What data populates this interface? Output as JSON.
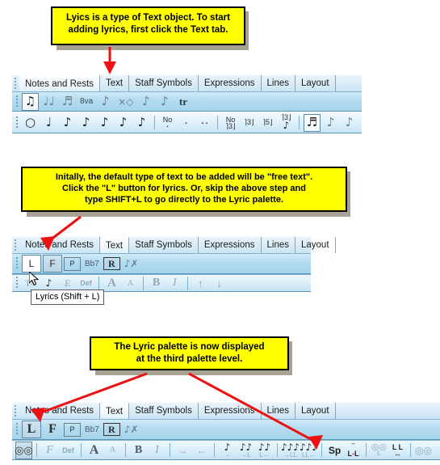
{
  "callouts": [
    {
      "id": "callout-text-tab",
      "lines": [
        "Lyics is a type of Text object. To start",
        "adding lyrics, first click the Text tab."
      ]
    },
    {
      "id": "callout-free-text",
      "lines": [
        "Initally, the default type of text to be added will be \"free text\".",
        "Click the \"L\" button for lyrics.  Or, skip the above step and",
        "type SHIFT+L to go directly to the Lyric palette."
      ]
    },
    {
      "id": "callout-third-level",
      "lines": [
        "The Lyric palette is now displayed",
        "at the third palette level."
      ]
    }
  ],
  "tabs": {
    "labels": [
      "Notes and Rests",
      "Text",
      "Staff Symbols",
      "Expressions",
      "Lines",
      "Layout"
    ],
    "active_top": "Notes and Rests",
    "active_middle": "Text",
    "active_bottom": "Text"
  },
  "section_top": {
    "row_articulations": [
      {
        "name": "beam-notes-icon",
        "glyph": "♫",
        "pressed": true
      },
      {
        "name": "slur-icon",
        "glyph": "♩♩",
        "pressed": false
      },
      {
        "name": "tuplet-notes-icon",
        "glyph": "♬",
        "pressed": false
      },
      {
        "name": "octave-8va-label",
        "glyph": "8va",
        "pressed": false
      },
      {
        "name": "articulation-icon",
        "glyph": "♩",
        "pressed": false
      },
      {
        "name": "noteheads-icon",
        "glyph": "x",
        "pressed": false
      },
      {
        "name": "grace-note-icon",
        "glyph": "♪",
        "pressed": false
      },
      {
        "name": "flag-icon",
        "glyph": "♪",
        "pressed": false
      },
      {
        "name": "trill-icon",
        "glyph": "tr",
        "pressed": false
      }
    ],
    "row_durations": [
      {
        "name": "whole-note-button",
        "glyph": "○"
      },
      {
        "name": "half-note-button",
        "glyph": "♩"
      },
      {
        "name": "quarter-note-button",
        "glyph": "♩"
      },
      {
        "name": "eighth-note-button",
        "glyph": "♪"
      },
      {
        "name": "sixteenth-note-button",
        "glyph": "♪"
      },
      {
        "name": "thirtysecond-note-button",
        "glyph": "♪"
      },
      {
        "name": "sixtyfourth-note-button",
        "glyph": "♪"
      }
    ],
    "row_dots": [
      {
        "name": "no-dot-button",
        "label": "No",
        "dots": 1
      },
      {
        "name": "one-dot-button",
        "label": "",
        "dots": 1
      },
      {
        "name": "two-dot-button",
        "label": "",
        "dots": 2
      }
    ],
    "row_tuplets": [
      {
        "name": "no-tuplet-button",
        "top": "No",
        "bottom": "3"
      },
      {
        "name": "triplet-button",
        "bottom": "3"
      },
      {
        "name": "quintuplet-button",
        "bottom": "5"
      },
      {
        "name": "custom-tuplet-button",
        "bottom": "3"
      }
    ],
    "row_stems": [
      {
        "name": "stem-auto-button",
        "pressed": true
      },
      {
        "name": "stem-up-button",
        "pressed": false
      },
      {
        "name": "stem-down-button",
        "pressed": false
      }
    ]
  },
  "text_palette": {
    "buttons": [
      {
        "name": "lyrics-L-button",
        "label": "L",
        "state_middle": "normal",
        "state_bottom": "pressed"
      },
      {
        "name": "free-text-F-button",
        "label": "F",
        "state_middle": "pressed",
        "state_bottom": "normal"
      },
      {
        "name": "page-text-button",
        "label": "P",
        "state_middle": "normal",
        "state_bottom": "normal"
      },
      {
        "name": "chord-symbol-button",
        "label": "Bb7",
        "state_middle": "normal",
        "state_bottom": "normal"
      },
      {
        "name": "rehearsal-mark-button",
        "label": "R",
        "state_middle": "normal",
        "state_bottom": "normal"
      },
      {
        "name": "hide-text-button",
        "label": "",
        "state_middle": "normal",
        "state_bottom": "normal"
      }
    ]
  },
  "middle_third_row": {
    "buttons": [
      {
        "name": "text-tool-icon",
        "label": "T&"
      },
      {
        "name": "dynamics-icon",
        "label": ""
      },
      {
        "name": "expression-E-icon",
        "label": "E"
      },
      {
        "name": "default-font-button",
        "label": "Def"
      },
      {
        "name": "font-size-large-button",
        "label": "A"
      },
      {
        "name": "font-size-small-button",
        "label": "A"
      },
      {
        "name": "bold-button",
        "label": "B"
      },
      {
        "name": "italic-button",
        "label": "I"
      },
      {
        "name": "align-top-button",
        "label": ""
      },
      {
        "name": "align-bottom-button",
        "label": ""
      }
    ]
  },
  "tooltip": {
    "name": "lyrics-tooltip",
    "text": "Lyrics (Shift + L)"
  },
  "lyric_palette": {
    "buttons": [
      {
        "name": "lyric-view-glasses-button",
        "label": "",
        "pressed": true
      },
      {
        "name": "lyric-font-F-button",
        "label": "F"
      },
      {
        "name": "lyric-default-button",
        "label": "Def"
      },
      {
        "name": "lyric-size-large-button",
        "label": "A"
      },
      {
        "name": "lyric-size-small-button",
        "label": "A"
      },
      {
        "name": "lyric-bold-button",
        "label": "B"
      },
      {
        "name": "lyric-italic-button",
        "label": "I"
      },
      {
        "name": "lyric-shift-right-button",
        "label": "→"
      },
      {
        "name": "lyric-shift-left-button",
        "label": "←"
      },
      {
        "name": "lyric-note-right-button",
        "label": ""
      },
      {
        "name": "lyric-to-L-right-button",
        "label": "→L"
      },
      {
        "name": "lyric-L-left-button",
        "label": "L←"
      },
      {
        "name": "lyric-to-LL-right-button",
        "label": "→LL"
      },
      {
        "name": "lyric-LL-left-button",
        "label": "LL←"
      },
      {
        "name": "lyric-spacing-sp-button",
        "label": "Sp"
      },
      {
        "name": "lyric-L-L-button",
        "label": "L-L"
      },
      {
        "name": "lyric-glasses-L-button",
        "label": ""
      },
      {
        "name": "lyric-LL-width-button",
        "label": "L L"
      },
      {
        "name": "lyric-glasses-slash-button",
        "label": ""
      },
      {
        "name": "lyric-slur-down-button",
        "label": "\\"
      },
      {
        "name": "lyric-slur-up-button",
        "label": "/"
      }
    ]
  },
  "colors": {
    "callout_bg": "#ffff00",
    "callout_border": "#000000",
    "shadow": "#a8a295",
    "arrow_red": "#ee1111",
    "toolbar_blue": "#a6d4ec",
    "tab_strip": "#d8ecf8",
    "page_bg": "#ffffff"
  }
}
